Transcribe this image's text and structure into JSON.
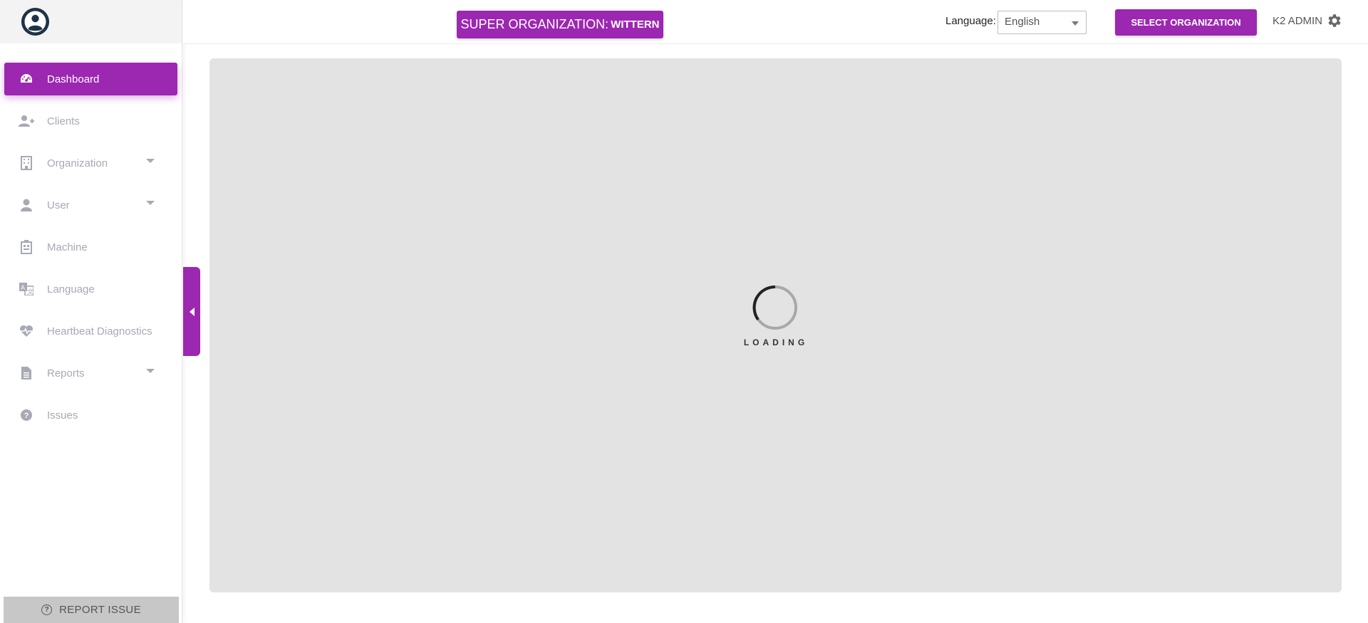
{
  "sidebar": {
    "items": [
      {
        "label": "Dashboard",
        "icon": "dashboard-icon",
        "active": true
      },
      {
        "label": "Clients",
        "icon": "add-user-icon"
      },
      {
        "label": "Organization",
        "icon": "building-icon",
        "expandable": true
      },
      {
        "label": "User",
        "icon": "user-icon",
        "expandable": true
      },
      {
        "label": "Machine",
        "icon": "machine-icon"
      },
      {
        "label": "Language",
        "icon": "translate-icon"
      },
      {
        "label": "Heartbeat Diagnostics",
        "icon": "heartbeat-icon"
      },
      {
        "label": "Reports",
        "icon": "document-icon",
        "expandable": true
      },
      {
        "label": "Issues",
        "icon": "question-circle-icon"
      }
    ],
    "report_issue": "REPORT ISSUE"
  },
  "header": {
    "super_org_prefix": "SUPER ORGANIZATION:",
    "super_org_name": "WITTERN",
    "language_label": "Language:",
    "language_value": "English",
    "select_org_label": "SELECT ORGANIZATION",
    "user_name": "K2 ADMIN"
  },
  "main": {
    "loading_text": "LOADING"
  },
  "colors": {
    "accent": "#9c27b0",
    "panel_bg": "#e3e3e3",
    "nav_text": "#a7a9b4"
  }
}
